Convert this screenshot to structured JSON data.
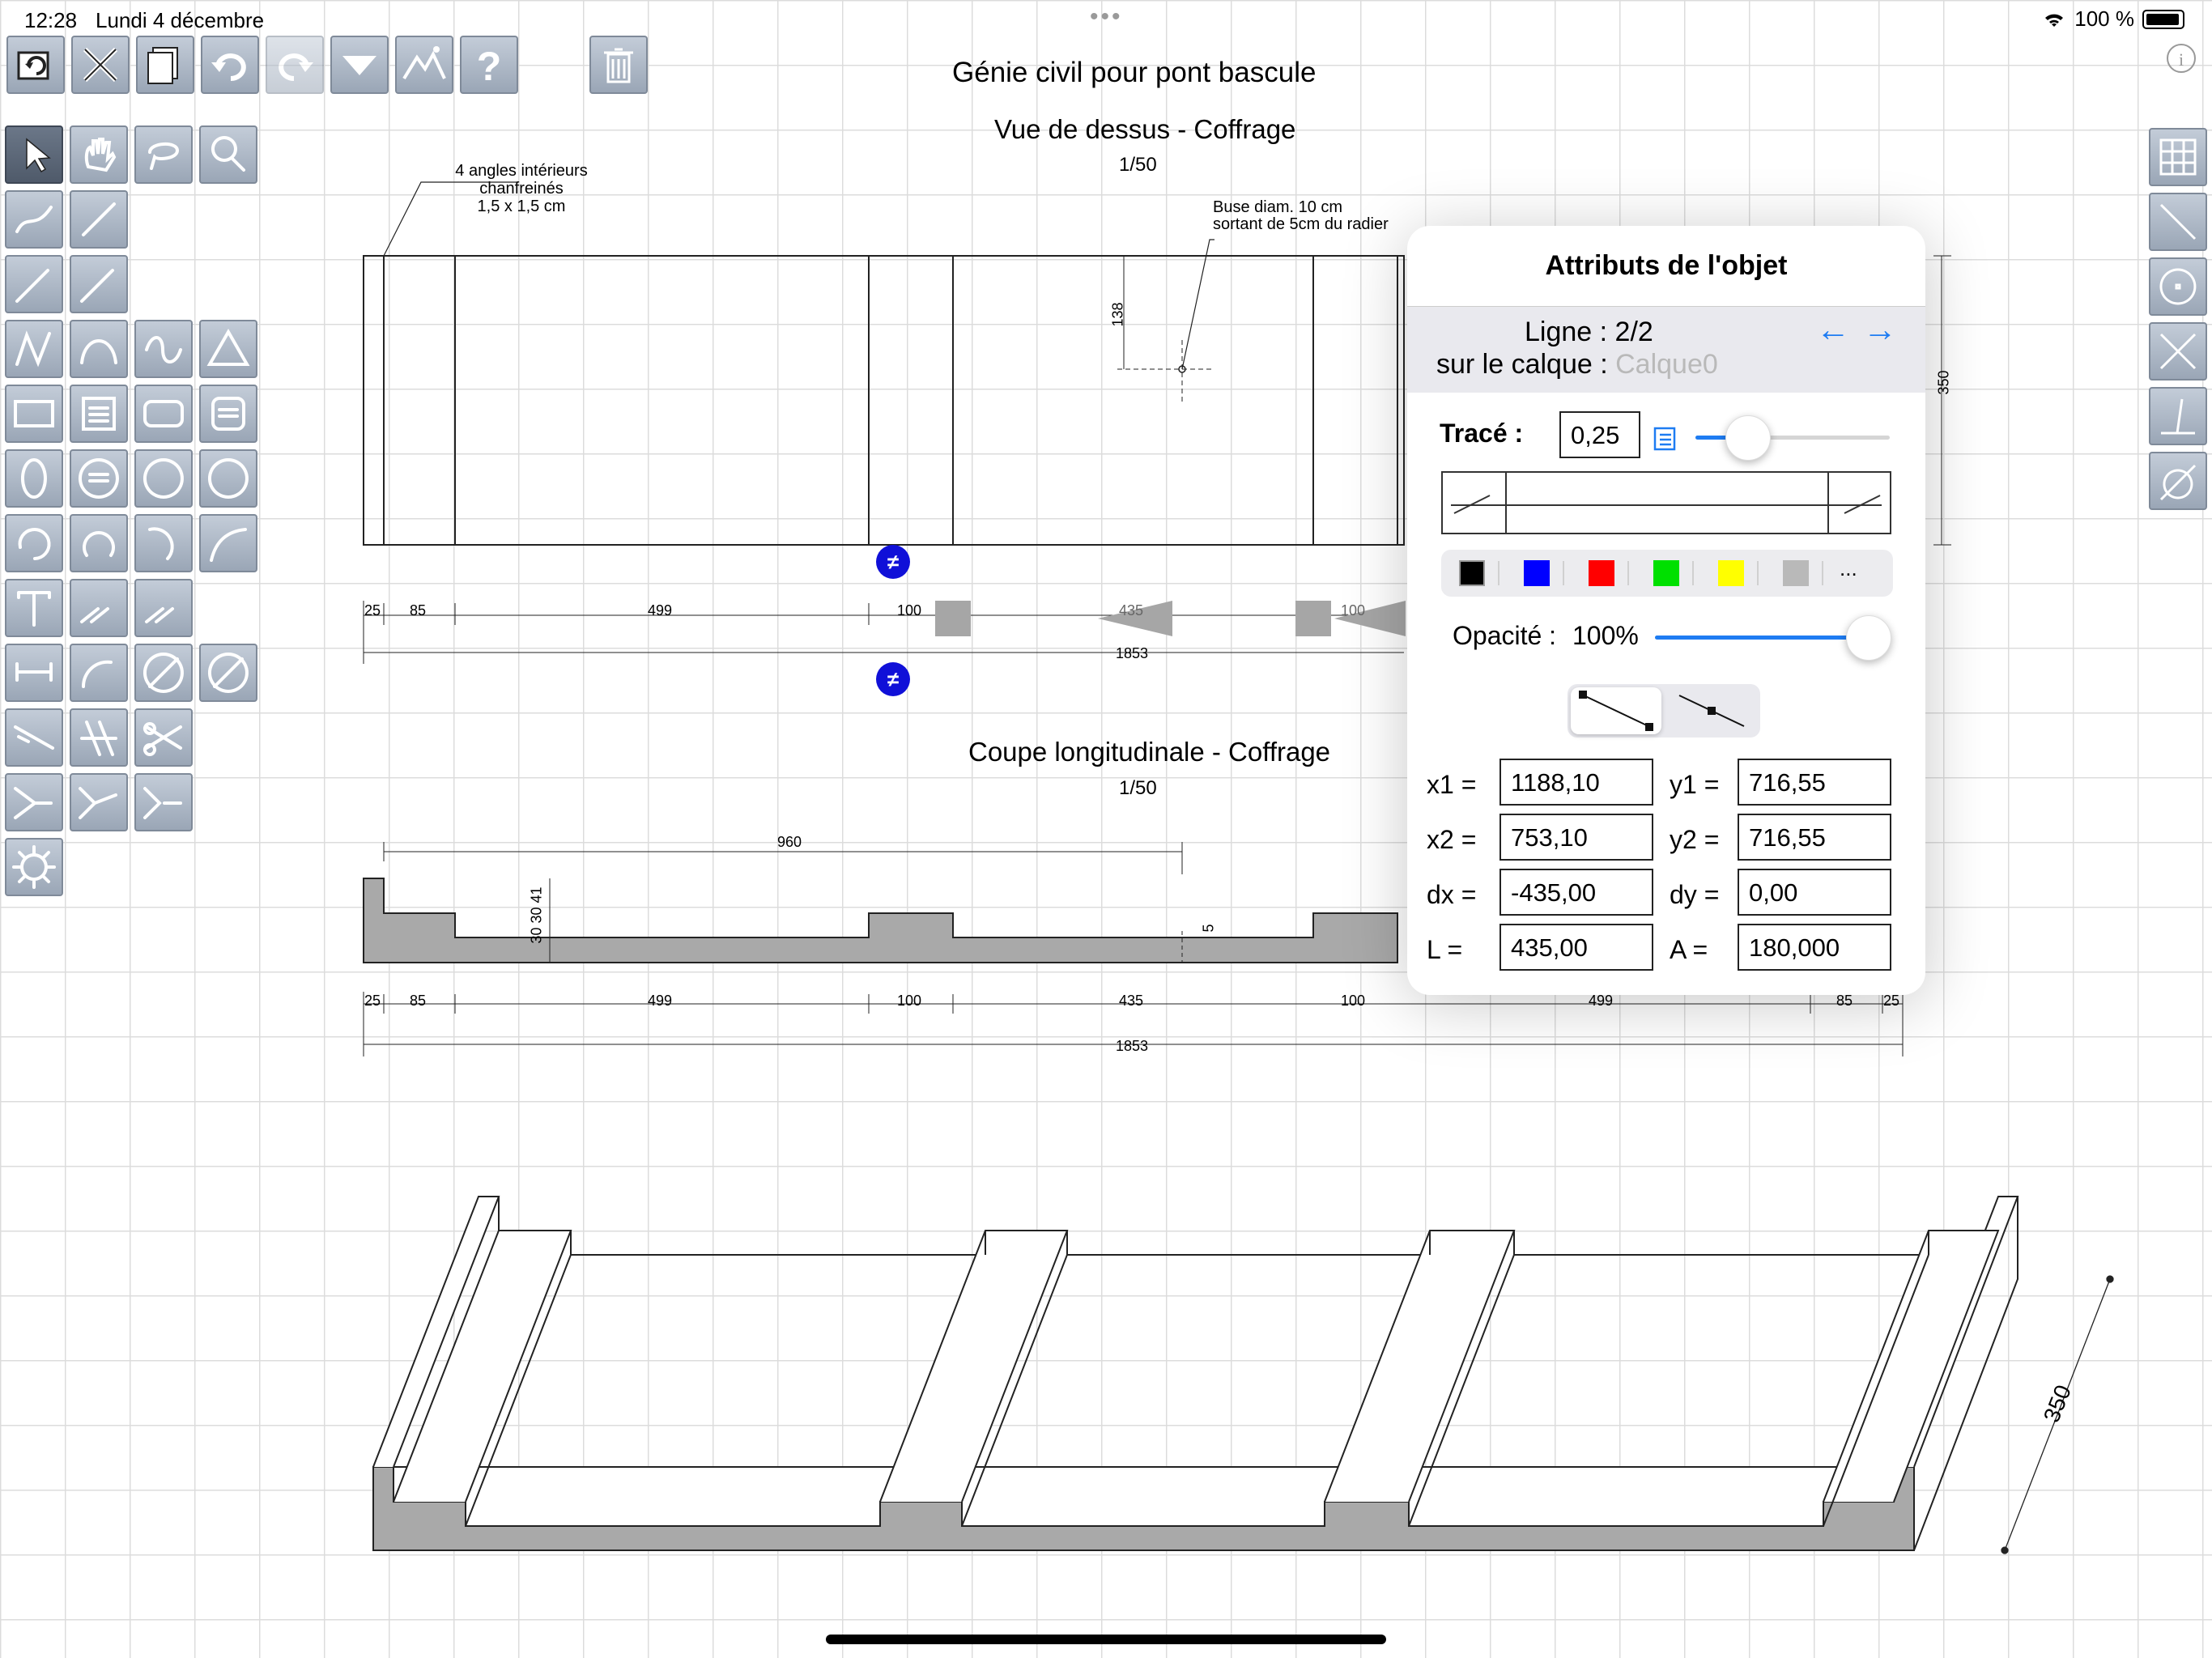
{
  "status_bar": {
    "time": "12:28",
    "date": "Lundi 4 décembre",
    "battery": "100 %"
  },
  "top_toolbar": [
    {
      "name": "open-file-icon",
      "glyph": "↻"
    },
    {
      "name": "tools-icon",
      "glyph": "✕"
    },
    {
      "name": "copy-pages-icon",
      "glyph": "▤"
    },
    {
      "name": "undo-icon",
      "glyph": "↶"
    },
    {
      "name": "redo-icon",
      "glyph": "↷"
    },
    {
      "name": "dropdown-icon",
      "glyph": "▼"
    },
    {
      "name": "image-icon",
      "glyph": "⛰"
    },
    {
      "name": "help-icon",
      "glyph": "?"
    },
    {
      "name": "trash-icon",
      "glyph": "🗑"
    }
  ],
  "drawing": {
    "main_title": "Génie civil pour pont bascule",
    "top_view_title": "Vue de dessus - Coffrage",
    "top_view_scale": "1/50",
    "note_angles": [
      "4 angles intérieurs",
      "chanfreinés",
      "1,5 x 1,5 cm"
    ],
    "note_buse": [
      "Buse diam. 10 cm",
      "sortant de 5cm du radier"
    ],
    "dim_138": "138",
    "dim_350_side": "350",
    "top_dims": [
      "25",
      "85",
      "499",
      "100",
      "435",
      "100"
    ],
    "top_total": "1853",
    "section_title": "Coupe longitudinale - Coffrage",
    "section_scale": "1/50",
    "section_dim_960": "960",
    "section_vert_dims": "30  30  41",
    "section_dim_5": "5",
    "section_dims": [
      "25",
      "85",
      "499",
      "100",
      "435",
      "100",
      "499",
      "85",
      "25"
    ],
    "section_total": "1853",
    "iso_dim": "350"
  },
  "popover": {
    "title": "Attributs de l'objet",
    "line_label": "Ligne :",
    "line_value": "2/2",
    "layer_label": "sur le calque :",
    "layer_value": "Calque0",
    "trace_label": "Tracé :",
    "trace_value": "0,25",
    "trace_slider": 0.2,
    "colors": [
      "#000000",
      "#0000ff",
      "#ff0000",
      "#00e000",
      "#ffff00",
      "#b9b9b9"
    ],
    "more_colors": "...",
    "opacity_label": "Opacité :",
    "opacity_value": "100%",
    "opacity_slider": 1.0,
    "x1_label": "x1 =",
    "x1": "1188,10",
    "y1_label": "y1 =",
    "y1": "716,55",
    "x2_label": "x2 =",
    "x2": "753,10",
    "y2_label": "y2 =",
    "y2": "716,55",
    "dx_label": "dx =",
    "dx": "-435,00",
    "dy_label": "dy =",
    "dy": "0,00",
    "L_label": "L =",
    "L": "435,00",
    "A_label": "A =",
    "A": "180,000"
  }
}
